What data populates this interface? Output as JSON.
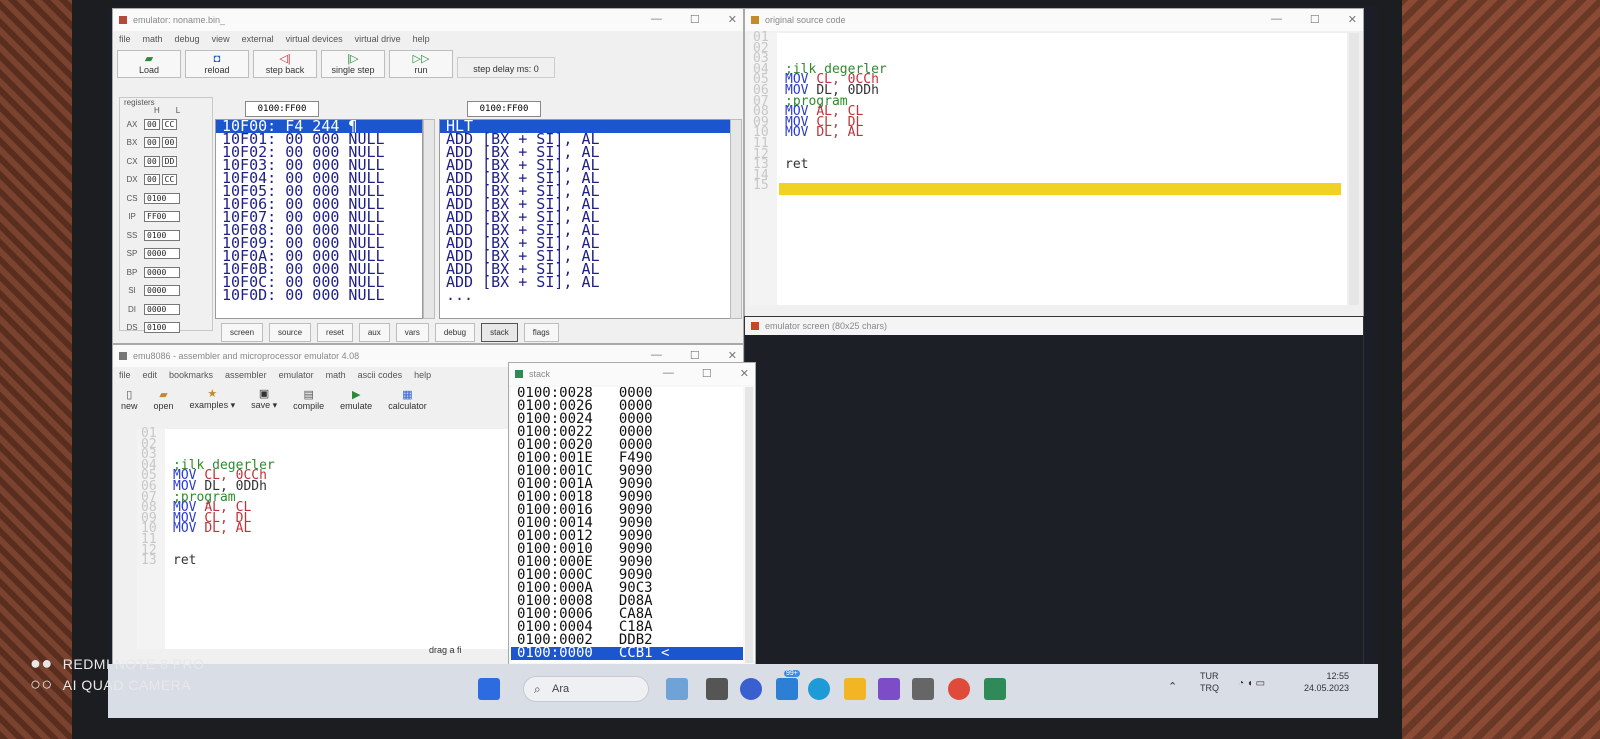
{
  "emulator": {
    "title": "emulator: noname.bin_",
    "menu": [
      "file",
      "math",
      "debug",
      "view",
      "external",
      "virtual devices",
      "virtual drive",
      "help"
    ],
    "toolbar": {
      "load": "Load",
      "reload": "reload",
      "step_back": "step back",
      "single_step": "single step",
      "run": "run",
      "step_delay": "step delay ms: 0"
    },
    "registers_label": "registers",
    "hl_h": "H",
    "hl_l": "L",
    "registers": [
      {
        "name": "AX",
        "h": "00",
        "l": "CC"
      },
      {
        "name": "BX",
        "h": "00",
        "l": "00"
      },
      {
        "name": "CX",
        "h": "00",
        "l": "DD"
      },
      {
        "name": "DX",
        "h": "00",
        "l": "CC"
      },
      {
        "name": "CS",
        "v": "0100"
      },
      {
        "name": "IP",
        "v": "FF00"
      },
      {
        "name": "SS",
        "v": "0100"
      },
      {
        "name": "SP",
        "v": "0000"
      },
      {
        "name": "BP",
        "v": "0000"
      },
      {
        "name": "SI",
        "v": "0000"
      },
      {
        "name": "DI",
        "v": "0000"
      },
      {
        "name": "DS",
        "v": "0100"
      }
    ],
    "addr_left": "0100:FF00",
    "addr_right": "0100:FF00",
    "memory": [
      "10F00: F4 244 ¶",
      "10F01: 00 000 NULL",
      "10F02: 00 000 NULL",
      "10F03: 00 000 NULL",
      "10F04: 00 000 NULL",
      "10F05: 00 000 NULL",
      "10F06: 00 000 NULL",
      "10F07: 00 000 NULL",
      "10F08: 00 000 NULL",
      "10F09: 00 000 NULL",
      "10F0A: 00 000 NULL",
      "10F0B: 00 000 NULL",
      "10F0C: 00 000 NULL",
      "10F0D: 00 000 NULL"
    ],
    "disasm": [
      "HLT",
      "ADD [BX + SI], AL",
      "ADD [BX + SI], AL",
      "ADD [BX + SI], AL",
      "ADD [BX + SI], AL",
      "ADD [BX + SI], AL",
      "ADD [BX + SI], AL",
      "ADD [BX + SI], AL",
      "ADD [BX + SI], AL",
      "ADD [BX + SI], AL",
      "ADD [BX + SI], AL",
      "ADD [BX + SI], AL",
      "ADD [BX + SI], AL",
      "..."
    ],
    "tabs": [
      "screen",
      "source",
      "reset",
      "aux",
      "vars",
      "debug",
      "stack",
      "flags"
    ]
  },
  "original_source": {
    "title": "original source code",
    "line_numbers": [
      "01",
      "02",
      "03",
      "04",
      "05",
      "06",
      "07",
      "08",
      "09",
      "10",
      "11",
      "12",
      "13",
      "14",
      "15"
    ],
    "lines": [
      {
        "n": 4,
        "parts": [
          {
            "t": ";ilk degerler",
            "c": "c-cmt"
          }
        ]
      },
      {
        "n": 5,
        "parts": [
          {
            "t": "MOV ",
            "c": "c-kw"
          },
          {
            "t": "CL, 0CCh",
            "c": "c-reg"
          }
        ]
      },
      {
        "n": 6,
        "parts": [
          {
            "t": "MOV ",
            "c": "c-kw"
          },
          {
            "t": "DL, 0DDh",
            "c": "c-txt"
          }
        ]
      },
      {
        "n": 7,
        "parts": [
          {
            "t": ";program",
            "c": "c-cmt"
          }
        ]
      },
      {
        "n": 8,
        "parts": [
          {
            "t": "MOV ",
            "c": "c-kw"
          },
          {
            "t": "AL, CL",
            "c": "c-reg"
          }
        ]
      },
      {
        "n": 9,
        "parts": [
          {
            "t": "MOV ",
            "c": "c-kw"
          },
          {
            "t": "CL, DL",
            "c": "c-reg"
          }
        ]
      },
      {
        "n": 10,
        "parts": [
          {
            "t": "MOV ",
            "c": "c-kw"
          },
          {
            "t": "DL, AL",
            "c": "c-reg"
          }
        ]
      },
      {
        "n": 13,
        "parts": [
          {
            "t": "ret",
            "c": "c-txt"
          }
        ]
      }
    ]
  },
  "emulator_screen": {
    "title": "emulator screen (80x25 chars)"
  },
  "emu8086": {
    "title": "emu8086 - assembler and microprocessor emulator 4.08",
    "menu": [
      "file",
      "edit",
      "bookmarks",
      "assembler",
      "emulator",
      "math",
      "ascii codes",
      "help"
    ],
    "toolbar": {
      "new": "new",
      "open": "open",
      "examples": "examples",
      "save": "save",
      "compile": "compile",
      "emulate": "emulate",
      "calculator": "calculator"
    },
    "line_numbers": [
      "01",
      "02",
      "03",
      "04",
      "05",
      "06",
      "07",
      "08",
      "09",
      "10",
      "11",
      "12",
      "13"
    ],
    "lines": [
      {
        "n": 4,
        "parts": [
          {
            "t": ";ilk degerler",
            "c": "c-cmt"
          }
        ]
      },
      {
        "n": 5,
        "parts": [
          {
            "t": "MOV ",
            "c": "c-kw"
          },
          {
            "t": "CL, 0CCh",
            "c": "c-reg"
          }
        ]
      },
      {
        "n": 6,
        "parts": [
          {
            "t": "MOV ",
            "c": "c-kw"
          },
          {
            "t": "DL, 0DDh",
            "c": "c-txt"
          }
        ]
      },
      {
        "n": 7,
        "parts": [
          {
            "t": ";program",
            "c": "c-cmt"
          }
        ]
      },
      {
        "n": 8,
        "parts": [
          {
            "t": "MOV ",
            "c": "c-kw"
          },
          {
            "t": "AL, CL",
            "c": "c-reg"
          }
        ]
      },
      {
        "n": 9,
        "parts": [
          {
            "t": "MOV ",
            "c": "c-kw"
          },
          {
            "t": "CL, DL",
            "c": "c-reg"
          }
        ]
      },
      {
        "n": 10,
        "parts": [
          {
            "t": "MOV ",
            "c": "c-kw"
          },
          {
            "t": "DL, AL",
            "c": "c-reg"
          }
        ]
      },
      {
        "n": 13,
        "parts": [
          {
            "t": "ret",
            "c": "c-txt"
          }
        ]
      }
    ],
    "status_drag": "drag a fi"
  },
  "stack": {
    "title": "stack",
    "rows": [
      {
        "a": "0100:0028",
        "v": "0000"
      },
      {
        "a": "0100:0026",
        "v": "0000"
      },
      {
        "a": "0100:0024",
        "v": "0000"
      },
      {
        "a": "0100:0022",
        "v": "0000"
      },
      {
        "a": "0100:0020",
        "v": "0000"
      },
      {
        "a": "0100:001E",
        "v": "F490"
      },
      {
        "a": "0100:001C",
        "v": "9090"
      },
      {
        "a": "0100:001A",
        "v": "9090"
      },
      {
        "a": "0100:0018",
        "v": "9090"
      },
      {
        "a": "0100:0016",
        "v": "9090"
      },
      {
        "a": "0100:0014",
        "v": "9090"
      },
      {
        "a": "0100:0012",
        "v": "9090"
      },
      {
        "a": "0100:0010",
        "v": "9090"
      },
      {
        "a": "0100:000E",
        "v": "9090"
      },
      {
        "a": "0100:000C",
        "v": "9090"
      },
      {
        "a": "0100:000A",
        "v": "90C3"
      },
      {
        "a": "0100:0008",
        "v": "D08A"
      },
      {
        "a": "0100:0006",
        "v": "CA8A"
      },
      {
        "a": "0100:0004",
        "v": "C18A"
      },
      {
        "a": "0100:0002",
        "v": "DDB2"
      },
      {
        "a": "0100:0000",
        "v": "CCB1 <"
      }
    ]
  },
  "taskbar": {
    "search": "Ara",
    "lang_top": "TUR",
    "lang_bottom": "TRQ",
    "time": "12:55",
    "date": "24.05.2023",
    "badge": "99+"
  },
  "watermark": {
    "line1": "REDMI NOTE 8 PRO",
    "line2": "AI QUAD CAMERA"
  },
  "colors": {
    "selection": "#1c56cf",
    "highlight_line": "#f0d225",
    "comment": "#2f8a2f",
    "keyword": "#2a3bd1",
    "register": "#c0323a"
  }
}
